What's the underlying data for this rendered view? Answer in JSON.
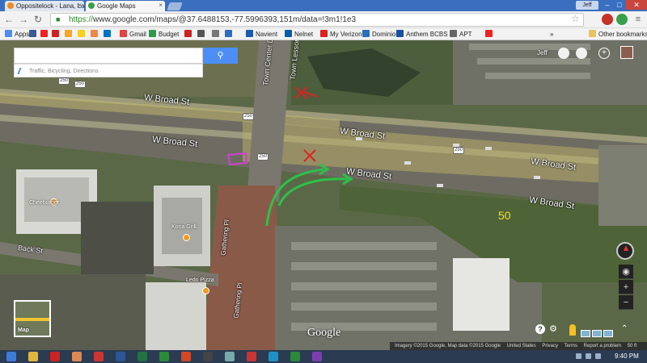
{
  "browser": {
    "tabs": [
      {
        "label": "Oppositelock - Lana, Lana",
        "favicon_color": "#f08a24"
      },
      {
        "label": "Google Maps",
        "favicon_color": "#3a9f4a"
      }
    ],
    "user_chip": "Jeff",
    "window_close": "✕",
    "nav": {
      "back": "←",
      "forward": "→",
      "reload": "C"
    },
    "url_scheme": "https://",
    "url_rest": "www.google.com/maps/@37.6488153,-77.5996393,151m/data=!3m1!1e3",
    "bookmark_star": "☆"
  },
  "bookmarks": {
    "items": [
      {
        "label": "Apps",
        "color": "#4c8ef5"
      },
      {
        "label": "",
        "color": "#3b5998"
      },
      {
        "label": "",
        "color": "#e22"
      },
      {
        "label": "",
        "color": "#c22"
      },
      {
        "label": "",
        "color": "#f5a623"
      },
      {
        "label": "",
        "color": "#f7d11e"
      },
      {
        "label": "",
        "color": "#e84"
      },
      {
        "label": "",
        "color": "#0072c6"
      },
      {
        "label": "Gmail",
        "color": "#d44"
      },
      {
        "label": "Budget",
        "color": "#2a9d4a"
      },
      {
        "label": "",
        "color": "#c22"
      },
      {
        "label": "",
        "color": "#555"
      },
      {
        "label": "",
        "color": "#777"
      },
      {
        "label": "",
        "color": "#2a6ebd"
      },
      {
        "label": "Navient",
        "color": "#1e5aa8"
      },
      {
        "label": "Nelnet",
        "color": "#0a5ca8"
      },
      {
        "label": "My Verizon",
        "color": "#d22"
      },
      {
        "label": "Dominion",
        "color": "#2b6fba"
      },
      {
        "label": "Anthem BCBS",
        "color": "#1a4f9c"
      },
      {
        "label": "APT",
        "color": "#666"
      },
      {
        "label": "",
        "color": "#e22"
      }
    ],
    "more": "»",
    "other": "Other bookmarks"
  },
  "map": {
    "search_placeholder": "",
    "search_icon": "search-icon",
    "traffic_label": "Traffic, Bicycling, Directions",
    "account_name": "Jeff",
    "roads": {
      "broad_st_1": "W Broad St",
      "broad_st_2": "W Broad St",
      "broad_st_3": "W Broad St",
      "broad_st_4": "W Broad St",
      "broad_st_5": "W Broad St",
      "broad_st_6": "W Broad St",
      "town_center_1": "Town Center Dr",
      "town_lesson": "Town Lesson",
      "back_st": "Back St",
      "gathering_pl_1": "Gathering Pl",
      "gathering_pl_2": "Gathering Pl"
    },
    "route_shields": [
      "250",
      "250",
      "250",
      "250",
      "250"
    ],
    "pois": {
      "cheeburger": "Cheeburger",
      "kona_grill": "Kona Grill",
      "ledo": "Ledo Pizza"
    },
    "annotation_speed": "50",
    "minimap_label": "Map",
    "google_logo": "Google",
    "help": "?",
    "zoom_in": "+",
    "zoom_out": "−",
    "footer": {
      "imagery": "Imagery ©2015 Google, Map data ©2015 Google",
      "country": "United States",
      "privacy": "Privacy",
      "terms": "Terms",
      "report": "Report a problem",
      "scale": "50 ft"
    }
  },
  "taskbar": {
    "clock": "9:40 PM",
    "apps": [
      {
        "name": "start",
        "color": "#3d7bd8"
      },
      {
        "name": "chrome",
        "color": "#e0b63a"
      },
      {
        "name": "app2",
        "color": "#c22"
      },
      {
        "name": "app3",
        "color": "#d85"
      },
      {
        "name": "app4",
        "color": "#c33"
      },
      {
        "name": "word",
        "color": "#2b5797"
      },
      {
        "name": "excel",
        "color": "#217346"
      },
      {
        "name": "app7",
        "color": "#2a8a3a"
      },
      {
        "name": "powerpoint",
        "color": "#d24726"
      },
      {
        "name": "app9",
        "color": "#444"
      },
      {
        "name": "app10",
        "color": "#7aa"
      },
      {
        "name": "app11",
        "color": "#c33"
      },
      {
        "name": "app12",
        "color": "#1e90c8"
      },
      {
        "name": "app13",
        "color": "#2a8a3a"
      },
      {
        "name": "app14",
        "color": "#7b3fb0"
      }
    ]
  }
}
